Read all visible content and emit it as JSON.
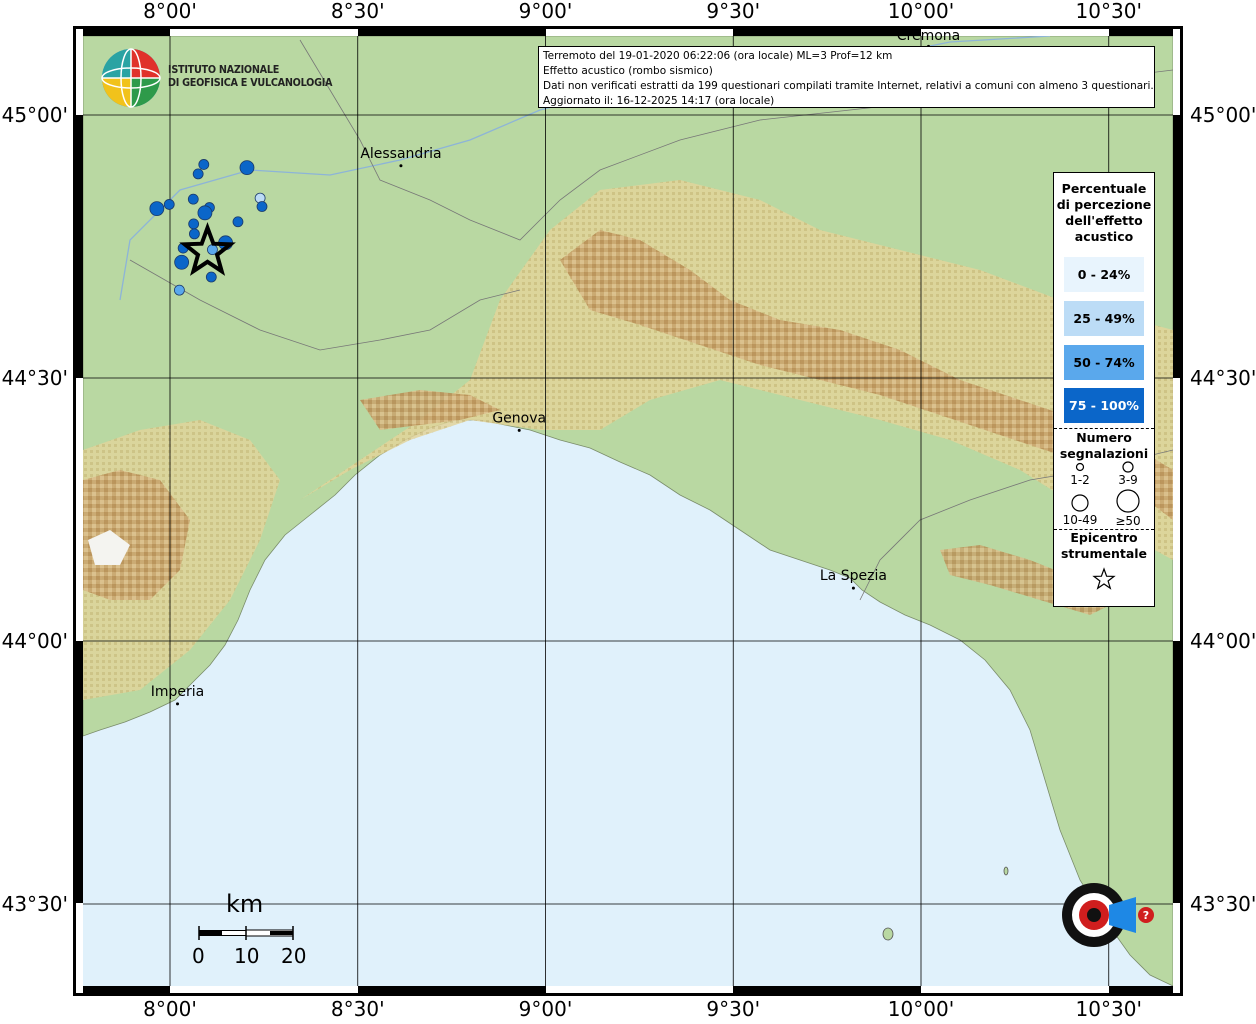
{
  "map": {
    "lon_labels": [
      {
        "lon": 8.0,
        "label": "8°00'"
      },
      {
        "lon": 8.5,
        "label": "8°30'"
      },
      {
        "lon": 9.0,
        "label": "9°00'"
      },
      {
        "lon": 9.5,
        "label": "9°30'"
      },
      {
        "lon": 10.0,
        "label": "10°00'"
      },
      {
        "lon": 10.5,
        "label": "10°30'"
      }
    ],
    "lat_labels": [
      {
        "lat": 45.0,
        "label": "45°00'"
      },
      {
        "lat": 44.5,
        "label": "44°30'"
      },
      {
        "lat": 44.0,
        "label": "44°00'"
      },
      {
        "lat": 43.5,
        "label": "43°30'"
      }
    ],
    "cities": [
      {
        "name": "Alessandria",
        "lon": 8.615,
        "lat": 44.913
      },
      {
        "name": "Genova",
        "lon": 8.93,
        "lat": 44.41
      },
      {
        "name": "La Spezia",
        "lon": 9.82,
        "lat": 44.11
      },
      {
        "name": "Imperia",
        "lon": 8.02,
        "lat": 43.89
      },
      {
        "name": "Cremona",
        "lon": 10.02,
        "lat": 45.14
      }
    ],
    "sea_color": "#e0f1fb",
    "land_color": "#b9d8a2",
    "mountain_color": "#c9a66f"
  },
  "info": {
    "line1": "Terremoto del 19-01-2020 06:22:06 (ora locale) ML=3 Prof=12 km",
    "line2": "Effetto acustico (rombo sismico)",
    "line3": "Dati non verificati estratti da 199 questionari compilati tramite Internet, relativi a comuni con almeno 3 questionari.",
    "line4": "Aggiornato il: 16-12-2025 14:17 (ora locale)"
  },
  "logo": {
    "line1": "ISTITUTO NAZIONALE",
    "line2": "DI GEOFISICA E VULCANOLOGIA"
  },
  "legend": {
    "title_lines": [
      "Percentuale",
      "di percezione",
      "dell'effetto",
      "acustico"
    ],
    "classes": [
      {
        "label": "0 - 24%",
        "color": "#e8f4fd",
        "text_color": "#000"
      },
      {
        "label": "25 - 49%",
        "color": "#bcdcf6",
        "text_color": "#000"
      },
      {
        "label": "50 - 74%",
        "color": "#5aa8ec",
        "text_color": "#000"
      },
      {
        "label": "75 - 100%",
        "color": "#0b66c9",
        "text_color": "#fff"
      }
    ],
    "count_title_lines": [
      "Numero",
      "segnalazioni"
    ],
    "count_classes": [
      "1-2",
      "3-9",
      "10-49",
      "≥50"
    ],
    "epicenter_title_lines": [
      "Epicentro",
      "strumentale"
    ]
  },
  "scale_bar": {
    "title": "km",
    "ticks": [
      "0",
      "10",
      "20"
    ]
  },
  "epicenter": {
    "lon": 8.1,
    "lat": 44.74
  },
  "observations": [
    {
      "lon": 8.09,
      "lat": 44.906,
      "size": 2,
      "pct_class": 3
    },
    {
      "lon": 8.205,
      "lat": 44.9,
      "size": 3,
      "pct_class": 3
    },
    {
      "lon": 8.075,
      "lat": 44.888,
      "size": 2,
      "pct_class": 3
    },
    {
      "lon": 8.24,
      "lat": 44.842,
      "size": 2,
      "pct_class": 1
    },
    {
      "lon": 7.998,
      "lat": 44.83,
      "size": 2,
      "pct_class": 3
    },
    {
      "lon": 7.965,
      "lat": 44.822,
      "size": 3,
      "pct_class": 3
    },
    {
      "lon": 8.062,
      "lat": 44.84,
      "size": 2,
      "pct_class": 3
    },
    {
      "lon": 8.105,
      "lat": 44.824,
      "size": 2,
      "pct_class": 3
    },
    {
      "lon": 8.245,
      "lat": 44.826,
      "size": 2,
      "pct_class": 3
    },
    {
      "lon": 8.093,
      "lat": 44.814,
      "size": 3,
      "pct_class": 3
    },
    {
      "lon": 8.063,
      "lat": 44.793,
      "size": 2,
      "pct_class": 3
    },
    {
      "lon": 8.181,
      "lat": 44.797,
      "size": 2,
      "pct_class": 3
    },
    {
      "lon": 8.065,
      "lat": 44.774,
      "size": 2,
      "pct_class": 3
    },
    {
      "lon": 8.148,
      "lat": 44.757,
      "size": 3,
      "pct_class": 3
    },
    {
      "lon": 8.035,
      "lat": 44.747,
      "size": 2,
      "pct_class": 3
    },
    {
      "lon": 8.113,
      "lat": 44.744,
      "size": 2,
      "pct_class": 2
    },
    {
      "lon": 8.031,
      "lat": 44.72,
      "size": 3,
      "pct_class": 3
    },
    {
      "lon": 8.11,
      "lat": 44.692,
      "size": 2,
      "pct_class": 3
    },
    {
      "lon": 8.025,
      "lat": 44.667,
      "size": 2,
      "pct_class": 2
    }
  ]
}
